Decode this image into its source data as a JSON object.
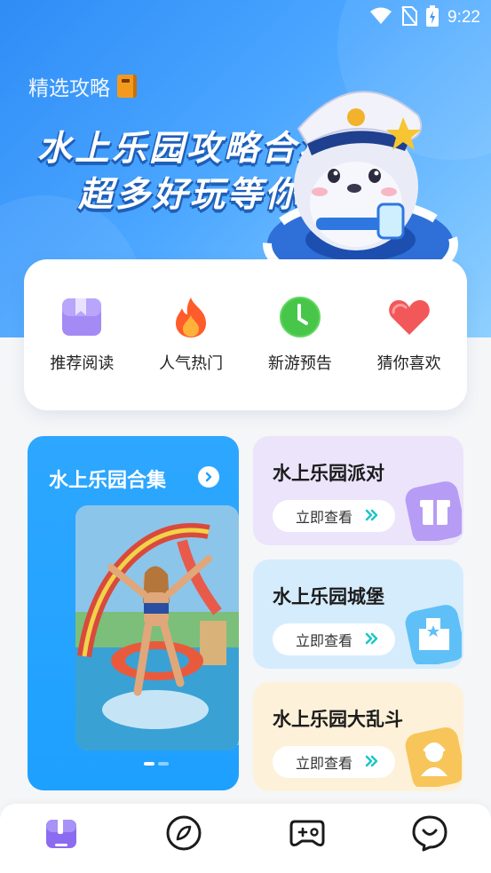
{
  "status_bar": {
    "time": "9:22"
  },
  "hero": {
    "label": "精选攻略",
    "title_line1": "水上乐园攻略合集",
    "title_line2": "超多好玩等你"
  },
  "categories": [
    {
      "label": "推荐阅读",
      "icon": "bookmark-icon",
      "color": "#9b7cf2"
    },
    {
      "label": "人气热门",
      "icon": "fire-icon",
      "color": "#ff5a2a"
    },
    {
      "label": "新游预告",
      "icon": "clock-icon",
      "color": "#4cc94a"
    },
    {
      "label": "猜你喜欢",
      "icon": "heart-icon",
      "color": "#f25a5a"
    }
  ],
  "feature": {
    "title": "水上乐园合集",
    "slides": 2,
    "active_slide": 0
  },
  "cards": [
    {
      "title": "水上乐园派对",
      "button": "立即查看",
      "icon": "gift-icon"
    },
    {
      "title": "水上乐园城堡",
      "button": "立即查看",
      "icon": "castle-icon"
    },
    {
      "title": "水上乐园大乱斗",
      "button": "立即查看",
      "icon": "character-icon"
    }
  ],
  "bottom_nav": [
    {
      "icon": "book-tab-icon",
      "active": true
    },
    {
      "icon": "compass-icon",
      "active": false
    },
    {
      "icon": "gamepad-icon",
      "active": false
    },
    {
      "icon": "chat-bubble-icon",
      "active": false
    }
  ],
  "colors": {
    "hero_start": "#2f8cf6",
    "feature_bg": "#2da7ff",
    "accent_teal": "#1fc6c6",
    "nav_active": "#8b6cf0"
  }
}
